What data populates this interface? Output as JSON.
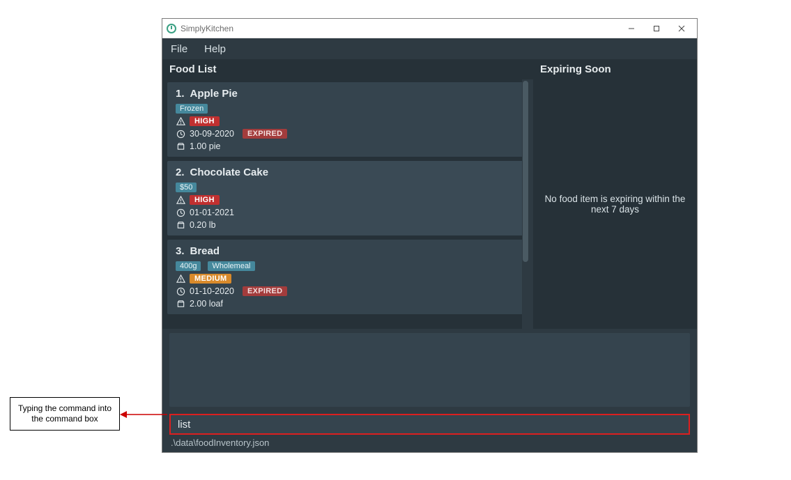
{
  "window": {
    "title": "SimplyKitchen"
  },
  "menubar": {
    "file": "File",
    "help": "Help"
  },
  "panels": {
    "food_list_header": "Food List",
    "expiring_header": "Expiring Soon",
    "expiring_empty": "No food item is expiring within the next 7 days"
  },
  "food_items": [
    {
      "index": "1.",
      "name": "Apple Pie",
      "tags": [
        "Frozen"
      ],
      "priority": "HIGH",
      "date": "30-09-2020",
      "expired": "EXPIRED",
      "quantity": "1.00 pie"
    },
    {
      "index": "2.",
      "name": "Chocolate Cake",
      "tags": [
        "$50"
      ],
      "priority": "HIGH",
      "date": "01-01-2021",
      "expired": "",
      "quantity": "0.20 lb"
    },
    {
      "index": "3.",
      "name": "Bread",
      "tags": [
        "400g",
        "Wholemeal"
      ],
      "priority": "MEDIUM",
      "date": "01-10-2020",
      "expired": "EXPIRED",
      "quantity": "2.00 loaf"
    }
  ],
  "command": {
    "value": "list"
  },
  "status": {
    "path": ".\\data\\foodInventory.json"
  },
  "annotation": {
    "text": "Typing the command into the command box"
  }
}
